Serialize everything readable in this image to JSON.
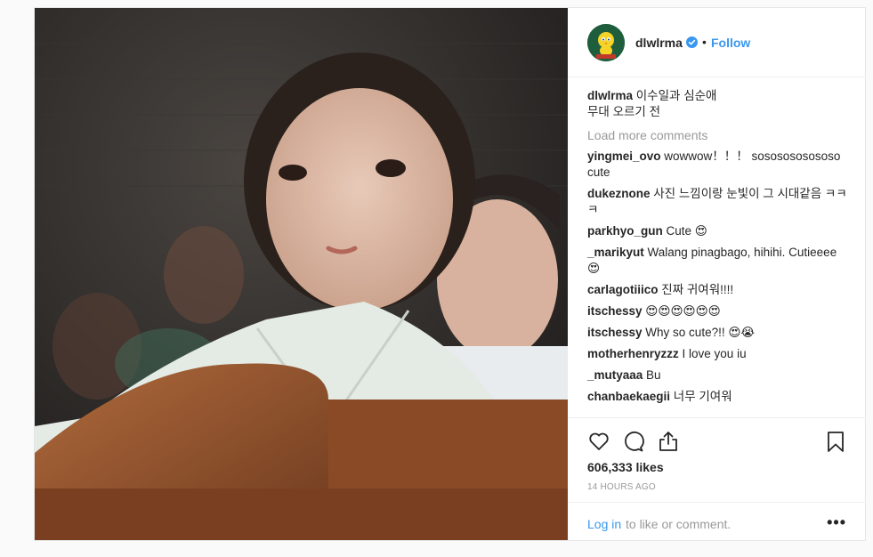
{
  "header": {
    "username": "dlwlrma",
    "separator": "•",
    "follow_label": "Follow"
  },
  "caption": {
    "user": "dlwlrma",
    "line1": " 이수일과 심순애",
    "line2": "무대 오르기 전"
  },
  "load_more_label": "Load more comments",
  "comments": [
    {
      "user": "yingmei_ovo",
      "text": " wowwow！！！ sososososososo cute"
    },
    {
      "user": "dukeznone",
      "text": " 사진 느낌이랑 눈빛이 그 시대같음 ㅋㅋㅋ"
    },
    {
      "user": "parkhyo_gun",
      "text": " Cute 😍"
    },
    {
      "user": "_marikyut",
      "text": " Walang pinagbago, hihihi. Cutieeee 😍"
    },
    {
      "user": "carlagotiiico",
      "text": " 진짜 귀여워!!!!"
    },
    {
      "user": "itschessy",
      "text": " 😍😍😍😍😍😍"
    },
    {
      "user": "itschessy",
      "text": " Why so cute?!! 😍😭"
    },
    {
      "user": "motherhenryzzz",
      "text": " I love you iu"
    },
    {
      "user": "_mutyaaa",
      "text": " Bu"
    },
    {
      "user": "chanbaekaegii",
      "text": " 너무 기여워"
    }
  ],
  "likes_label": "606,333 likes",
  "time_label": "14 HOURS AGO",
  "login": {
    "link": "Log in",
    "rest": " to like or comment."
  },
  "more_label": "•••",
  "icons": {
    "like": "heart-icon",
    "comment": "comment-icon",
    "share": "share-icon",
    "save": "bookmark-icon",
    "verified": "verified-badge-icon",
    "avatar": "tweety-avatar"
  },
  "colors": {
    "accent": "#3897f0",
    "muted": "#999999",
    "text": "#262626",
    "border": "#efefef"
  }
}
